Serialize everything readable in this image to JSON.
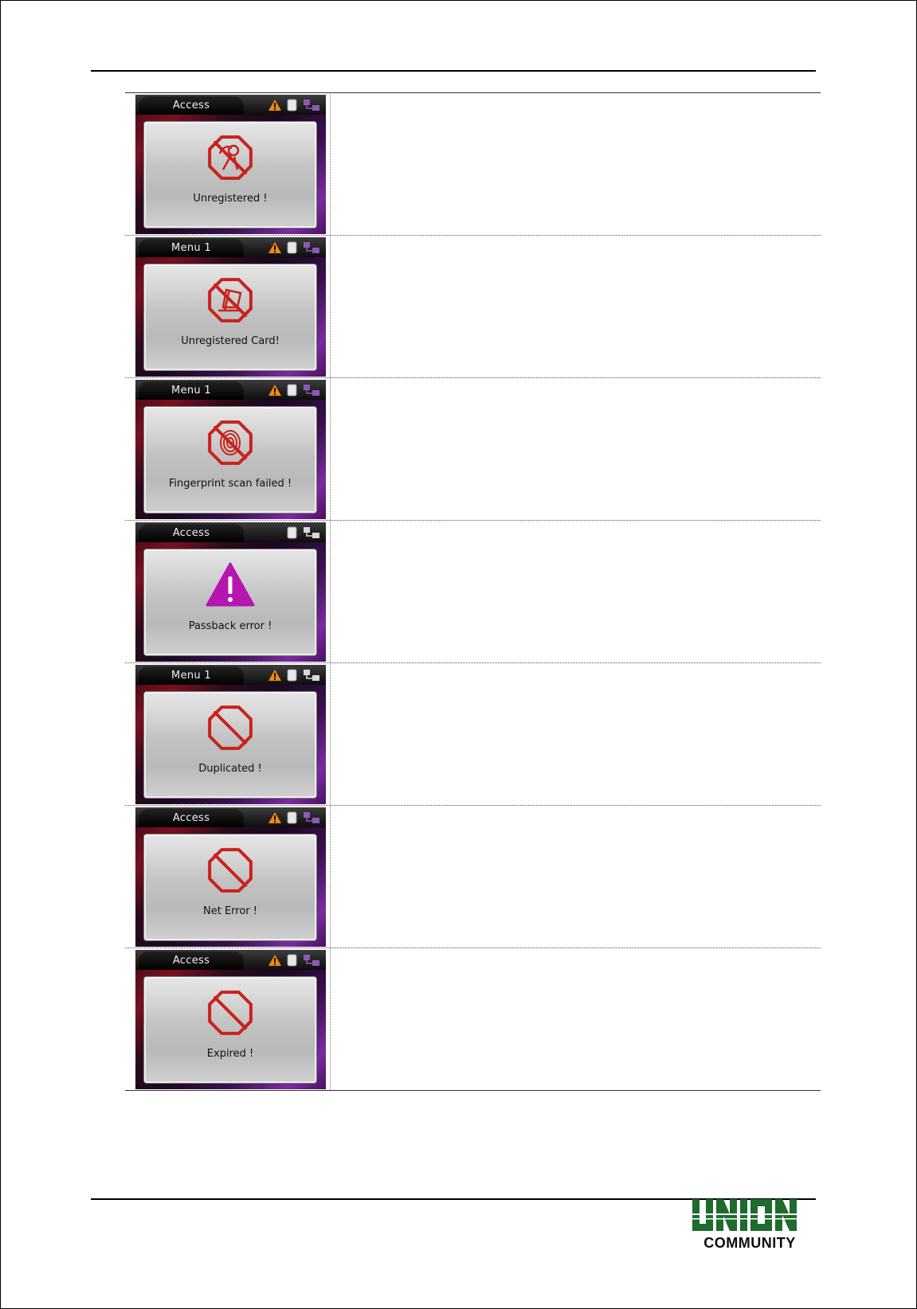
{
  "rows": [
    {
      "title": "Access",
      "message": "Unregistered !",
      "icon": "unregistered-user-icon",
      "warning": true,
      "network": "purple"
    },
    {
      "title": "Menu 1",
      "message": "Unregistered Card!",
      "icon": "unregistered-card-icon",
      "warning": true,
      "network": "purple"
    },
    {
      "title": "Menu 1",
      "message": "Fingerprint scan failed !",
      "icon": "fingerprint-failed-icon",
      "warning": true,
      "network": "purple"
    },
    {
      "title": "Access",
      "message": "Passback error !",
      "icon": "passback-warning-icon",
      "warning": false,
      "network": "white"
    },
    {
      "title": "Menu 1",
      "message": "Duplicated !",
      "icon": "prohibited-icon",
      "warning": true,
      "network": "white"
    },
    {
      "title": "Access",
      "message": "Net Error !",
      "icon": "prohibited-icon",
      "warning": true,
      "network": "purple"
    },
    {
      "title": "Access",
      "message": "Expired !",
      "icon": "prohibited-icon",
      "warning": true,
      "network": "purple"
    }
  ],
  "logo": {
    "brand": "UNION",
    "word": "COMMUNITY",
    "color": "#1e6b2e"
  },
  "colors": {
    "error_red": "#c8221e",
    "passback_purple": "#b516b0",
    "warning_orange": "#f08a12"
  }
}
